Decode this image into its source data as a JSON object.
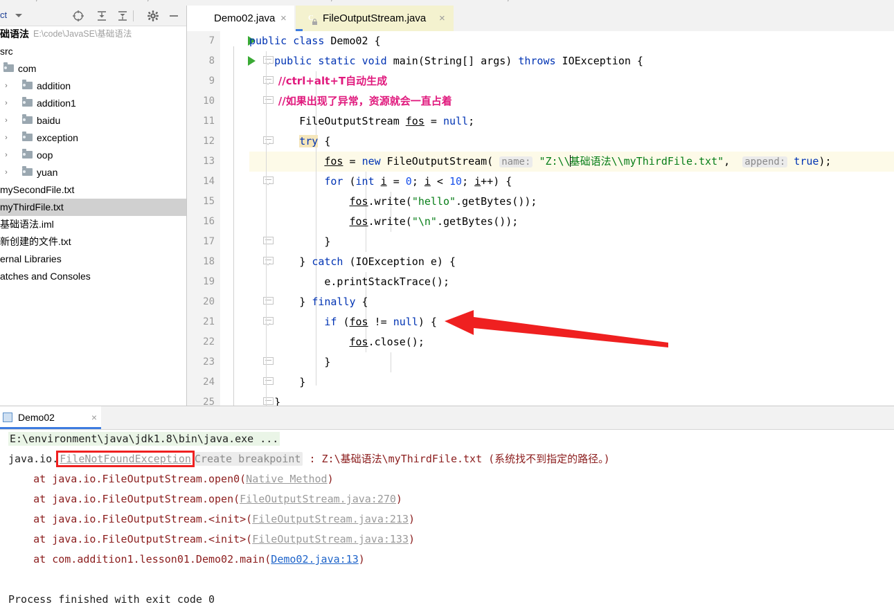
{
  "window": {
    "ide": "IntelliJ IDEA"
  },
  "sidebar": {
    "toolbar": {
      "project_label": "ct",
      "icons": [
        {
          "name": "locate-target-icon",
          "glyph": "locate"
        },
        {
          "name": "expand-all-icon",
          "glyph": "expand"
        },
        {
          "name": "collapse-all-icon",
          "glyph": "collapse"
        },
        {
          "name": "settings-gear-icon",
          "glyph": "gear"
        },
        {
          "name": "hide-panel-icon",
          "glyph": "minus"
        }
      ]
    },
    "tree": [
      {
        "label": "础语法",
        "path": "E:\\code\\JavaSE\\基础语法",
        "type": "module",
        "indent": 0,
        "arrow": "",
        "icon": "none",
        "bold": true
      },
      {
        "label": "src",
        "path": "",
        "type": "source-folder",
        "indent": 0,
        "arrow": "",
        "icon": "none",
        "bold": false
      },
      {
        "label": "com",
        "path": "",
        "type": "package",
        "indent": 0,
        "arrow": "",
        "icon": "folder",
        "bold": false
      },
      {
        "label": "addition",
        "path": "",
        "type": "package",
        "indent": 1,
        "arrow": "›",
        "icon": "folder",
        "bold": false
      },
      {
        "label": "addition1",
        "path": "",
        "type": "package",
        "indent": 1,
        "arrow": "›",
        "icon": "folder",
        "bold": false
      },
      {
        "label": "baidu",
        "path": "",
        "type": "package",
        "indent": 1,
        "arrow": "›",
        "icon": "folder",
        "bold": false
      },
      {
        "label": "exception",
        "path": "",
        "type": "package",
        "indent": 1,
        "arrow": "›",
        "icon": "folder",
        "bold": false
      },
      {
        "label": "oop",
        "path": "",
        "type": "package",
        "indent": 1,
        "arrow": "›",
        "icon": "folder",
        "bold": false
      },
      {
        "label": "yuan",
        "path": "",
        "type": "package",
        "indent": 1,
        "arrow": "›",
        "icon": "folder",
        "bold": false
      },
      {
        "label": "mySecondFile.txt",
        "path": "",
        "type": "file",
        "indent": 0,
        "arrow": "",
        "icon": "none",
        "bold": false
      },
      {
        "label": "myThirdFile.txt",
        "path": "",
        "type": "file",
        "indent": 0,
        "arrow": "",
        "icon": "none",
        "bold": false,
        "selected": true
      },
      {
        "label": "基础语法.iml",
        "path": "",
        "type": "file",
        "indent": 0,
        "arrow": "",
        "icon": "none",
        "bold": false
      },
      {
        "label": "新创建的文件.txt",
        "path": "",
        "type": "file",
        "indent": 0,
        "arrow": "",
        "icon": "none",
        "bold": false
      },
      {
        "label": "ernal Libraries",
        "path": "",
        "type": "node",
        "indent": 0,
        "arrow": "",
        "icon": "none",
        "bold": false
      },
      {
        "label": "atches and Consoles",
        "path": "",
        "type": "node",
        "indent": 0,
        "arrow": "",
        "icon": "none",
        "bold": false
      }
    ]
  },
  "editor_tabs": [
    {
      "label": "Demo02.java",
      "active": true,
      "locked": false,
      "close": "×"
    },
    {
      "label": "FileOutputStream.java",
      "active": false,
      "locked": true,
      "close": "×"
    }
  ],
  "editor": {
    "first_line": 7,
    "highlighted_line": 13,
    "line_numbers": [
      7,
      8,
      9,
      10,
      11,
      12,
      13,
      14,
      15,
      16,
      17,
      18,
      19,
      20,
      21,
      22,
      23,
      24,
      25
    ],
    "code_lines": [
      {
        "n": 7,
        "text": "public class Demo02 {"
      },
      {
        "n": 8,
        "text": "    public static void main(String[] args) throws IOException {"
      },
      {
        "n": 9,
        "text": "        //ctrl+alt+T自动生成"
      },
      {
        "n": 10,
        "text": "        //如果出现了异常，资源就会一直占着"
      },
      {
        "n": 11,
        "text": "        FileOutputStream fos = null;"
      },
      {
        "n": 12,
        "text": "        try {"
      },
      {
        "n": 13,
        "text": "            fos = new FileOutputStream( name: \"Z:\\\\基础语法\\\\myThirdFile.txt\",  append: true);"
      },
      {
        "n": 14,
        "text": "            for (int i = 0; i < 10; i++) {"
      },
      {
        "n": 15,
        "text": "                fos.write(\"hello\".getBytes());"
      },
      {
        "n": 16,
        "text": "                fos.write(\"\\n\".getBytes());"
      },
      {
        "n": 17,
        "text": "            }"
      },
      {
        "n": 18,
        "text": "        } catch (IOException e) {"
      },
      {
        "n": 19,
        "text": "            e.printStackTrace();"
      },
      {
        "n": 20,
        "text": "        } finally {"
      },
      {
        "n": 21,
        "text": "            if (fos != null) {"
      },
      {
        "n": 22,
        "text": "                fos.close();"
      },
      {
        "n": 23,
        "text": "            }"
      },
      {
        "n": 24,
        "text": "        }"
      },
      {
        "n": 25,
        "text": "    }"
      }
    ],
    "param_hints": [
      "name:",
      "append:"
    ],
    "run_gutter_lines": [
      7,
      8
    ],
    "annotation": {
      "type": "red-arrow",
      "points_to_line": 21
    }
  },
  "run_panel": {
    "tab": {
      "label": "Demo02",
      "close": "×"
    },
    "console": {
      "command_line": "E:\\environment\\java\\jdk1.8\\bin\\java.exe ...",
      "exception_prefix": "java.io.",
      "exception_class": "FileNotFoundException",
      "create_breakpoint": "Create breakpoint",
      "exception_message": " : Z:\\基础语法\\myThirdFile.txt (系统找不到指定的路径。)",
      "stack": [
        {
          "prefix": "    at java.io.FileOutputStream.open0(",
          "link": "Native Method",
          "suffix": ")",
          "blue": false
        },
        {
          "prefix": "    at java.io.FileOutputStream.open(",
          "link": "FileOutputStream.java:270",
          "suffix": ")",
          "blue": false
        },
        {
          "prefix": "    at java.io.FileOutputStream.<init>(",
          "link": "FileOutputStream.java:213",
          "suffix": ")",
          "blue": false
        },
        {
          "prefix": "    at java.io.FileOutputStream.<init>(",
          "link": "FileOutputStream.java:133",
          "suffix": ")",
          "blue": false
        },
        {
          "prefix": "    at com.addition1.lesson01.Demo02.main(",
          "link": "Demo02.java:13",
          "suffix": ")",
          "blue": true
        }
      ],
      "exit_line": "Process finished with exit code 0"
    }
  },
  "colors": {
    "keyword": "#0033b3",
    "string": "#067d17",
    "number": "#1750eb",
    "comment_zh": "#e0197d",
    "exception_text": "#8b1c1c",
    "annotation_red": "#ef2020",
    "tab_accent": "#3d7ce0",
    "selection_gray": "#d0d0d0",
    "caret_row": "#fdfae8",
    "console_cmd_bg": "#eaf5e7"
  }
}
